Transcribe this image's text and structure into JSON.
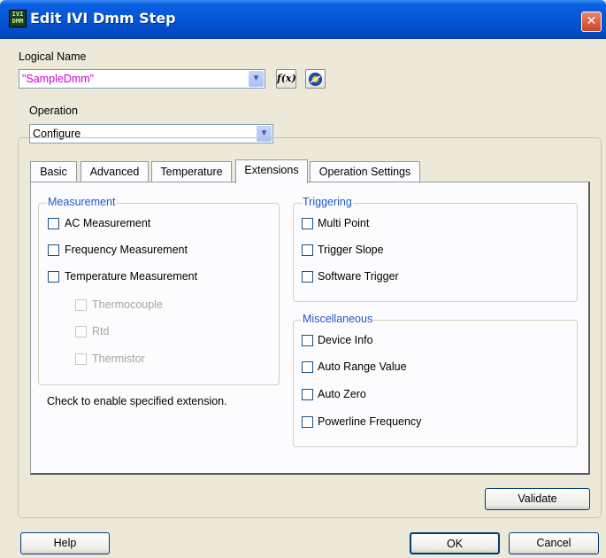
{
  "window": {
    "title": "Edit IVI Dmm Step",
    "icon_text": "IVI\nDMM"
  },
  "logical_name": {
    "label": "Logical Name",
    "value": "\"SampleDmm\"",
    "value_color": "#d400d4"
  },
  "operation": {
    "label": "Operation",
    "value": "Configure"
  },
  "tabs": [
    {
      "label": "Basic"
    },
    {
      "label": "Advanced"
    },
    {
      "label": "Temperature"
    },
    {
      "label": "Extensions",
      "active": true
    },
    {
      "label": "Operation Settings"
    }
  ],
  "measurement": {
    "title": "Measurement",
    "items": [
      {
        "label": "AC Measurement",
        "checked": false
      },
      {
        "label": "Frequency Measurement",
        "checked": false
      },
      {
        "label": "Temperature Measurement",
        "checked": false
      }
    ],
    "sub_items": [
      {
        "label": "Thermocouple",
        "disabled": true
      },
      {
        "label": "Rtd",
        "disabled": true
      },
      {
        "label": "Thermistor",
        "disabled": true
      }
    ]
  },
  "hint": "Check to enable specified extension.",
  "triggering": {
    "title": "Triggering",
    "items": [
      {
        "label": "Multi Point"
      },
      {
        "label": "Trigger Slope"
      },
      {
        "label": "Software Trigger"
      }
    ]
  },
  "miscellaneous": {
    "title": "Miscellaneous",
    "items": [
      {
        "label": "Device Info"
      },
      {
        "label": "Auto Range Value"
      },
      {
        "label": "Auto Zero"
      },
      {
        "label": "Powerline Frequency"
      }
    ]
  },
  "buttons": {
    "validate": "Validate",
    "help": "Help",
    "ok": "OK",
    "cancel": "Cancel"
  },
  "icons": {
    "close": "close-icon",
    "function": "function-icon",
    "browse": "browse-icon",
    "dropdown": "chevron-down-icon"
  }
}
